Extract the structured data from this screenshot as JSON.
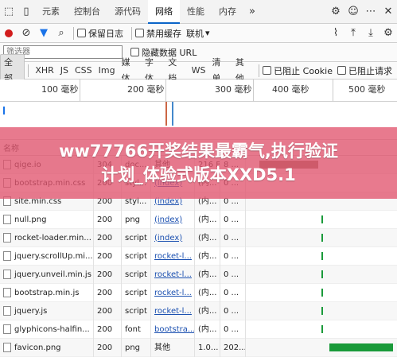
{
  "tabs": [
    "元素",
    "控制台",
    "源代码",
    "网络",
    "性能",
    "内存"
  ],
  "tools": {
    "preserve_log": "保留日志",
    "disable_cache": "禁用缓存",
    "throttle": "联机"
  },
  "filter": {
    "placeholder": "筛选器",
    "hide_data_url": "隐藏数据 URL"
  },
  "types": [
    "全部",
    "XHR",
    "JS",
    "CSS",
    "Img",
    "媒体",
    "字体",
    "文档",
    "WS",
    "清单",
    "其他"
  ],
  "blocked_cookie": "已阻止 Cookie",
  "blocked_request": "已阻止请求",
  "timeline_ticks": [
    "100 毫秒",
    "200 毫秒",
    "300 毫秒",
    "400 毫秒",
    "500 毫秒"
  ],
  "header": {
    "name": "名称"
  },
  "rows": [
    {
      "name": "qige.io",
      "status": "304",
      "type": "doc...",
      "initiator": "其他",
      "size": "216 B",
      "time": "8 ...",
      "link": false
    },
    {
      "name": "bootstrap.min.css",
      "status": "200",
      "type": "styl...",
      "initiator": "(index)",
      "size": "(内...",
      "time": "0 ...",
      "link": true
    },
    {
      "name": "site.min.css",
      "status": "200",
      "type": "styl...",
      "initiator": "(index)",
      "size": "(内...",
      "time": "0 ...",
      "link": true
    },
    {
      "name": "null.png",
      "status": "200",
      "type": "png",
      "initiator": "(index)",
      "size": "(内...",
      "time": "0 ...",
      "link": true
    },
    {
      "name": "rocket-loader.min...",
      "status": "200",
      "type": "script",
      "initiator": "(index)",
      "size": "(内...",
      "time": "0 ...",
      "link": true
    },
    {
      "name": "jquery.scrollUp.mi...",
      "status": "200",
      "type": "script",
      "initiator": "rocket-l...",
      "size": "(内...",
      "time": "0 ...",
      "link": true
    },
    {
      "name": "jquery.unveil.min.js",
      "status": "200",
      "type": "script",
      "initiator": "rocket-l...",
      "size": "(内...",
      "time": "0 ...",
      "link": true
    },
    {
      "name": "bootstrap.min.js",
      "status": "200",
      "type": "script",
      "initiator": "rocket-l...",
      "size": "(内...",
      "time": "0 ...",
      "link": true
    },
    {
      "name": "jquery.js",
      "status": "200",
      "type": "script",
      "initiator": "rocket-l...",
      "size": "(内...",
      "time": "0 ...",
      "link": true
    },
    {
      "name": "glyphicons-halfin...",
      "status": "200",
      "type": "font",
      "initiator": "bootstra...",
      "size": "(内...",
      "time": "0 ...",
      "link": true
    },
    {
      "name": "favicon.png",
      "status": "200",
      "type": "png",
      "initiator": "其他",
      "size": "1.0...",
      "time": "202...",
      "link": false
    }
  ],
  "banner": {
    "line1": "ww77766开奖结果最霸气,执行验证",
    "line2": "计划_体验式版本XXD5.1"
  }
}
